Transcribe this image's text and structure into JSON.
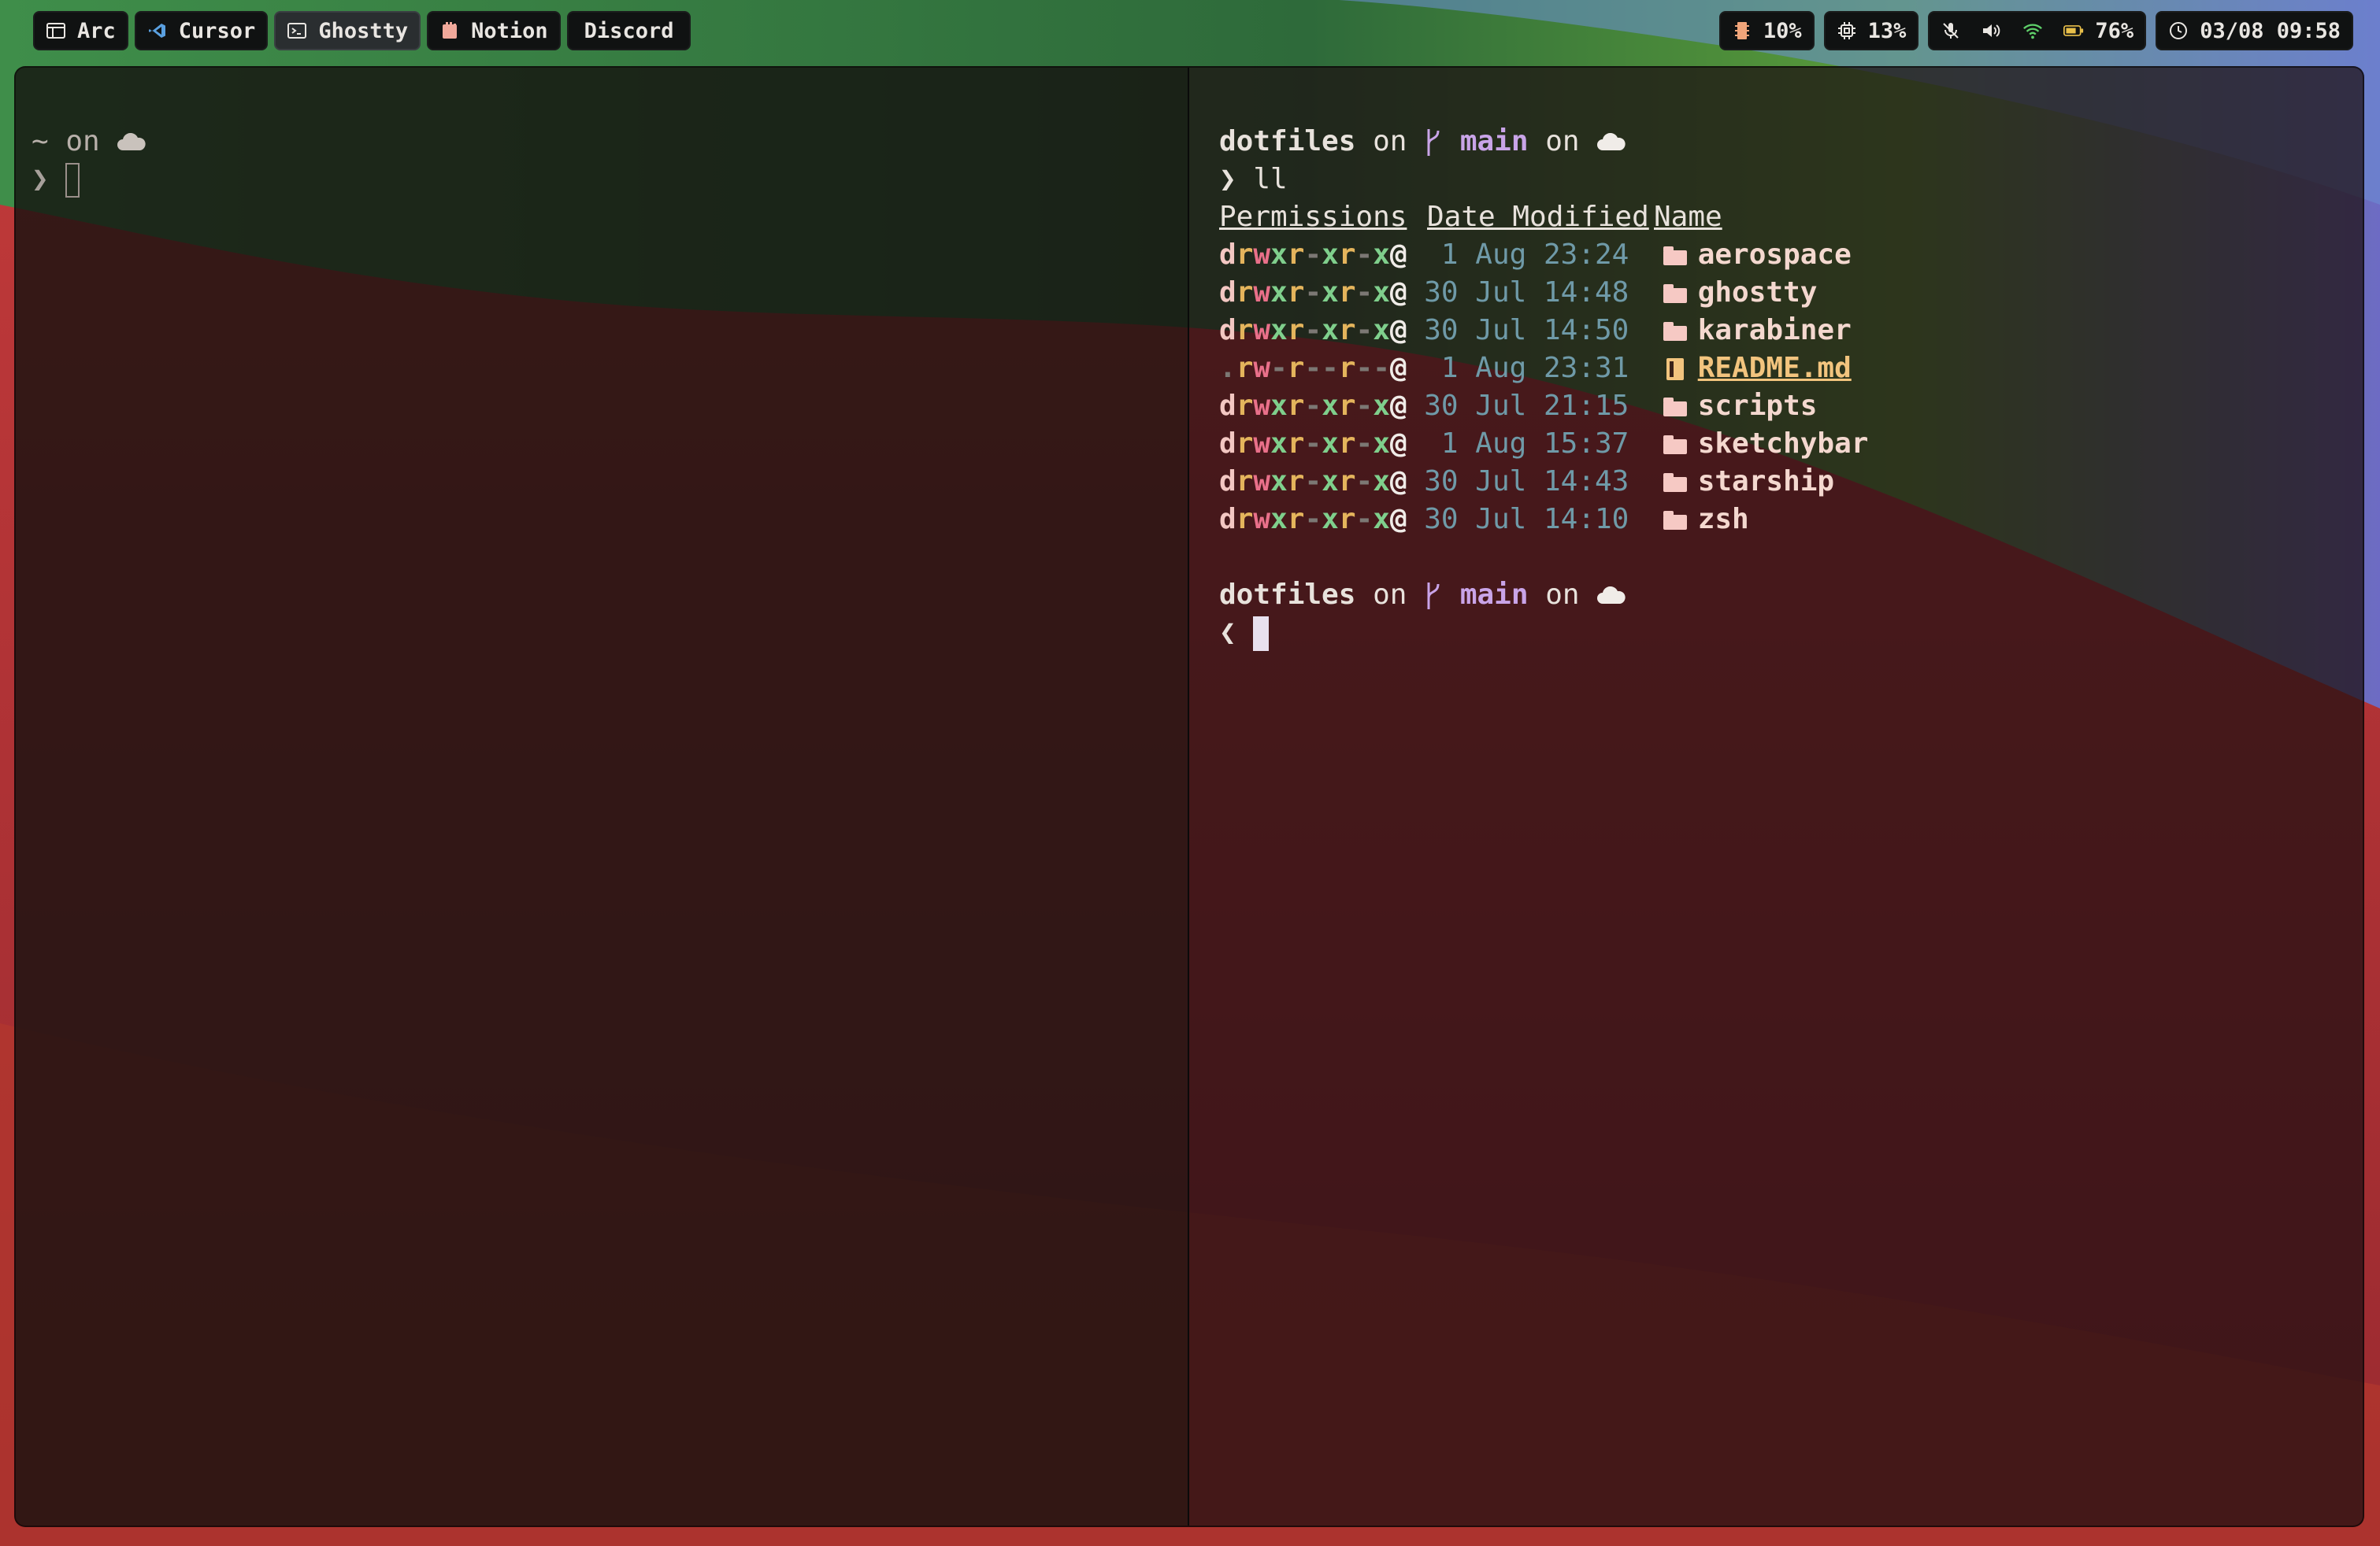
{
  "menubar": {
    "apps": [
      {
        "label": "Arc",
        "icon": "browser-window-icon",
        "active": false
      },
      {
        "label": "Cursor",
        "icon": "vscode-icon",
        "active": false
      },
      {
        "label": "Ghostty",
        "icon": "terminal-icon",
        "active": true
      },
      {
        "label": "Notion",
        "icon": "notion-icon",
        "active": false
      },
      {
        "label": "Discord",
        "icon": "",
        "active": false
      }
    ],
    "status": {
      "memory": "10%",
      "cpu": "13%",
      "battery": "76%",
      "datetime": "03/08 09:58"
    }
  },
  "left_pane": {
    "prompt_dir": "~",
    "prompt_on": "on",
    "prompt_symbol": "❯"
  },
  "right_pane": {
    "prompt_dir": "dotfiles",
    "on1": "on",
    "branch": "main",
    "on2": "on",
    "prompt_symbol": "❯",
    "command": "ll",
    "headers": {
      "permissions": "Permissions",
      "date": "Date Modified",
      "name": "Name"
    },
    "entries": [
      {
        "perm": "drwxr-xr-x@",
        "date": " 1 Aug 23:24",
        "name": "aerospace",
        "type": "dir"
      },
      {
        "perm": "drwxr-xr-x@",
        "date": "30 Jul 14:48",
        "name": "ghostty",
        "type": "dir"
      },
      {
        "perm": "drwxr-xr-x@",
        "date": "30 Jul 14:50",
        "name": "karabiner",
        "type": "dir"
      },
      {
        "perm": ".rw-r--r--@",
        "date": " 1 Aug 23:31",
        "name": "README.md",
        "type": "file"
      },
      {
        "perm": "drwxr-xr-x@",
        "date": "30 Jul 21:15",
        "name": "scripts",
        "type": "dir"
      },
      {
        "perm": "drwxr-xr-x@",
        "date": " 1 Aug 15:37",
        "name": "sketchybar",
        "type": "dir"
      },
      {
        "perm": "drwxr-xr-x@",
        "date": "30 Jul 14:43",
        "name": "starship",
        "type": "dir"
      },
      {
        "perm": "drwxr-xr-x@",
        "date": "30 Jul 14:10",
        "name": "zsh",
        "type": "dir"
      }
    ],
    "prompt2_dir": "dotfiles",
    "prompt2_on1": "on",
    "prompt2_branch": "main",
    "prompt2_on2": "on",
    "prompt2_symbol": "❮"
  },
  "colors": {
    "perm_d": "#f3c7c2",
    "perm_r": "#e4b45c",
    "perm_w": "#e9708a",
    "perm_x": "#7fcf8c",
    "date": "#6f9aa8",
    "branch": "#c9a4e8"
  }
}
